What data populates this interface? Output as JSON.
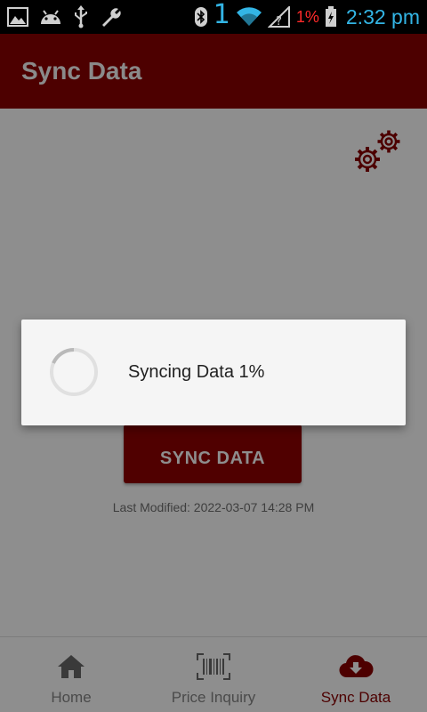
{
  "status_bar": {
    "icons_left": [
      "image-icon",
      "android-icon",
      "usb-icon",
      "wrench-icon"
    ],
    "icons_right": [
      "bluetooth-icon",
      "wifi-icon",
      "signal-icon",
      "battery-charging-icon"
    ],
    "indicator": "1",
    "battery_percent": "1%",
    "time": "2:32 pm"
  },
  "app_bar": {
    "title": "Sync Data"
  },
  "main": {
    "sync_button_label": "SYNC DATA",
    "last_modified": "Last Modified: 2022-03-07 14:28 PM"
  },
  "dialog": {
    "message": "Syncing Data 1%",
    "progress_percent": 1
  },
  "bottom_nav": {
    "items": [
      {
        "label": "Home",
        "icon": "home-icon"
      },
      {
        "label": "Price Inquiry",
        "icon": "barcode-scan-icon"
      },
      {
        "label": "Sync Data",
        "icon": "cloud-download-icon",
        "active": true
      }
    ]
  },
  "colors": {
    "primary": "#4d0000",
    "overlay": "#8e8e8e",
    "status_blue": "#33b5e5",
    "battery_red": "#ff2a2a"
  }
}
